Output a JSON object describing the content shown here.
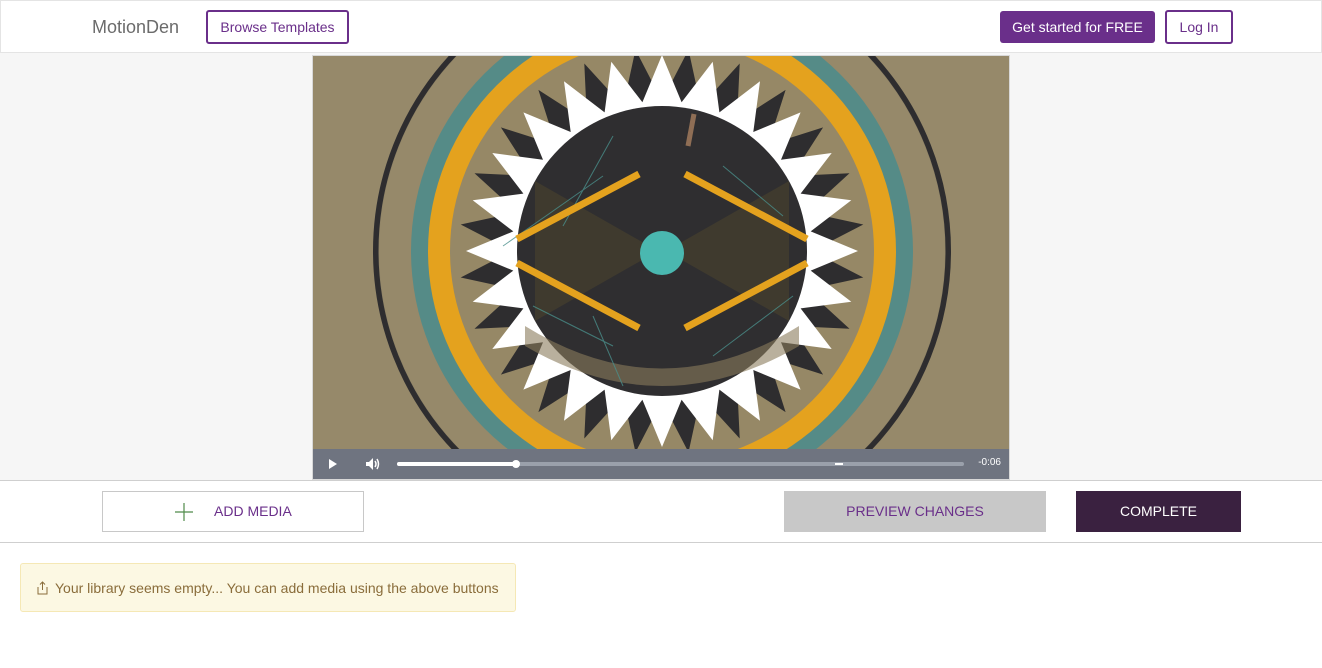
{
  "header": {
    "logo": "MotionDen",
    "browse_label": "Browse Templates",
    "cta_label": "Get started for FREE",
    "login_label": "Log In"
  },
  "player": {
    "progress": 0.21,
    "time_remaining": "-0:06"
  },
  "toolbar": {
    "add_media_label": "ADD MEDIA",
    "preview_label": "PREVIEW CHANGES",
    "complete_label": "COMPLETE"
  },
  "library": {
    "empty_message": "Your library seems empty... You can add media using the above buttons"
  },
  "colors": {
    "brand": "#6a2f8a",
    "complete_bg": "#3a2140",
    "teal": "#558b87",
    "orange": "#e4a21e",
    "dark": "#2e2d2f"
  }
}
